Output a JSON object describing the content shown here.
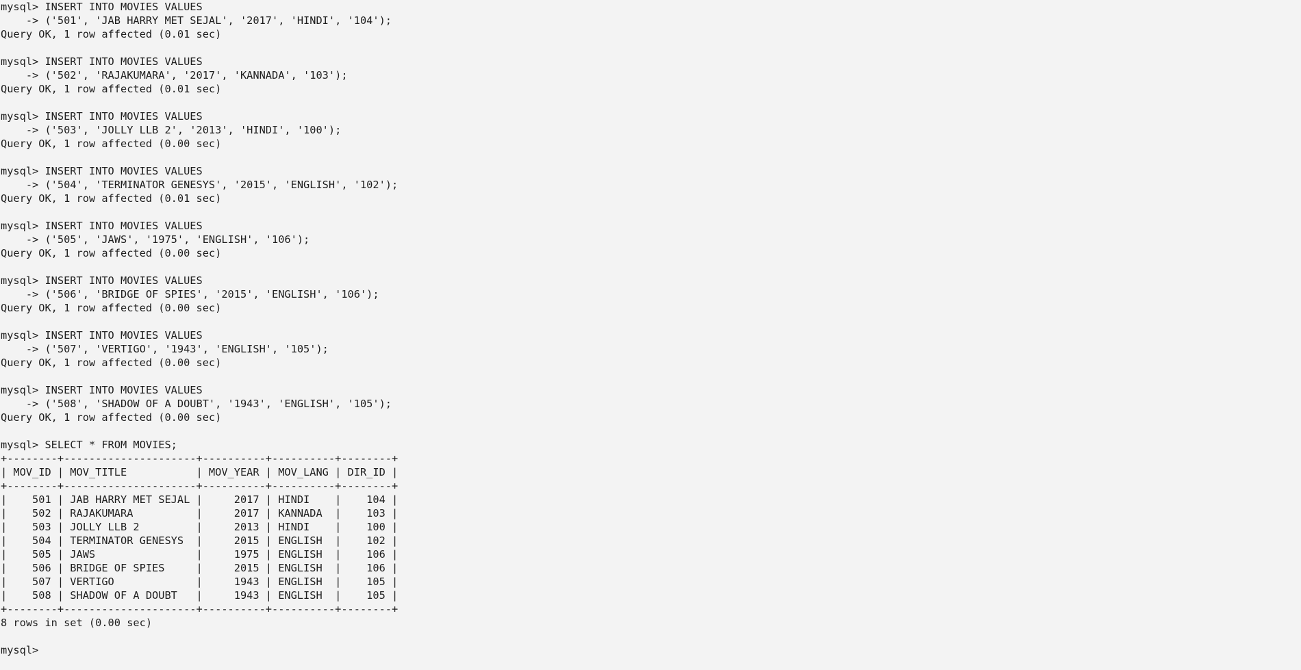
{
  "terminal": {
    "background_color": "#f3f3f3",
    "text_color": "#1e1e1e",
    "lines": [
      "mysql> INSERT INTO MOVIES VALUES",
      "    -> ('501', 'JAB HARRY MET SEJAL', '2017', 'HINDI', '104');",
      "Query OK, 1 row affected (0.01 sec)",
      "",
      "mysql> INSERT INTO MOVIES VALUES",
      "    -> ('502', 'RAJAKUMARA', '2017', 'KANNADA', '103');",
      "Query OK, 1 row affected (0.01 sec)",
      "",
      "mysql> INSERT INTO MOVIES VALUES",
      "    -> ('503', 'JOLLY LLB 2', '2013', 'HINDI', '100');",
      "Query OK, 1 row affected (0.00 sec)",
      "",
      "mysql> INSERT INTO MOVIES VALUES",
      "    -> ('504', 'TERMINATOR GENESYS', '2015', 'ENGLISH', '102');",
      "Query OK, 1 row affected (0.01 sec)",
      "",
      "mysql> INSERT INTO MOVIES VALUES",
      "    -> ('505', 'JAWS', '1975', 'ENGLISH', '106');",
      "Query OK, 1 row affected (0.00 sec)",
      "",
      "mysql> INSERT INTO MOVIES VALUES",
      "    -> ('506', 'BRIDGE OF SPIES', '2015', 'ENGLISH', '106');",
      "Query OK, 1 row affected (0.00 sec)",
      "",
      "mysql> INSERT INTO MOVIES VALUES",
      "    -> ('507', 'VERTIGO', '1943', 'ENGLISH', '105');",
      "Query OK, 1 row affected (0.00 sec)",
      "",
      "mysql> INSERT INTO MOVIES VALUES",
      "    -> ('508', 'SHADOW OF A DOUBT', '1943', 'ENGLISH', '105');",
      "Query OK, 1 row affected (0.00 sec)",
      "",
      "mysql> SELECT * FROM MOVIES;",
      "+--------+---------------------+----------+----------+--------+",
      "| MOV_ID | MOV_TITLE           | MOV_YEAR | MOV_LANG | DIR_ID |",
      "+--------+---------------------+----------+----------+--------+",
      "|    501 | JAB HARRY MET SEJAL |     2017 | HINDI    |    104 |",
      "|    502 | RAJAKUMARA          |     2017 | KANNADA  |    103 |",
      "|    503 | JOLLY LLB 2         |     2013 | HINDI    |    100 |",
      "|    504 | TERMINATOR GENESYS  |     2015 | ENGLISH  |    102 |",
      "|    505 | JAWS                |     1975 | ENGLISH  |    106 |",
      "|    506 | BRIDGE OF SPIES     |     2015 | ENGLISH  |    106 |",
      "|    507 | VERTIGO             |     1943 | ENGLISH  |    105 |",
      "|    508 | SHADOW OF A DOUBT   |     1943 | ENGLISH  |    105 |",
      "+--------+---------------------+----------+----------+--------+",
      "8 rows in set (0.00 sec)",
      ""
    ],
    "prompt": "mysql> "
  }
}
